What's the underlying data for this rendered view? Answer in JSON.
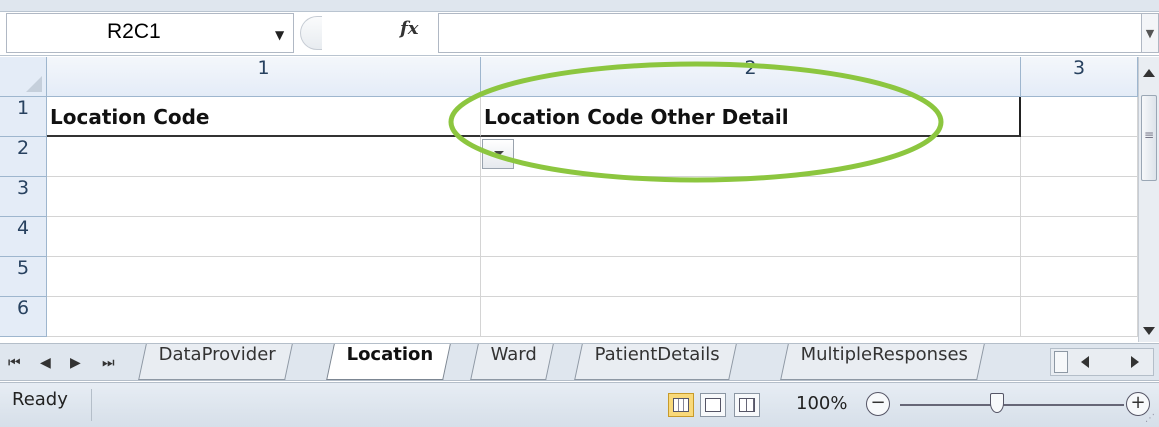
{
  "formula_bar": {
    "name_box": "R2C1",
    "fx_label": "fx",
    "formula_value": ""
  },
  "columns": [
    {
      "label": "1"
    },
    {
      "label": "2"
    },
    {
      "label": "3"
    }
  ],
  "rows": [
    {
      "label": "1",
      "cells": [
        "Location Code",
        "Location Code Other Detail",
        ""
      ]
    },
    {
      "label": "2",
      "cells": [
        "",
        "",
        ""
      ]
    },
    {
      "label": "3",
      "cells": [
        "",
        "",
        ""
      ]
    },
    {
      "label": "4",
      "cells": [
        "",
        "",
        ""
      ]
    },
    {
      "label": "5",
      "cells": [
        "",
        "",
        ""
      ]
    },
    {
      "label": "6",
      "cells": [
        "",
        "",
        ""
      ]
    }
  ],
  "sheet_tabs": [
    {
      "label": "DataProvider",
      "active": false
    },
    {
      "label": "Location",
      "active": true
    },
    {
      "label": "Ward",
      "active": false
    },
    {
      "label": "PatientDetails",
      "active": false
    },
    {
      "label": "MultipleResponses",
      "active": false
    }
  ],
  "status_bar": {
    "status": "Ready",
    "zoom": "100%",
    "zoom_minus": "−",
    "zoom_plus": "+"
  },
  "icons": {
    "nav_first": "⏮",
    "nav_prev": "◀",
    "nav_next": "▶",
    "nav_last": "⏭"
  },
  "colors": {
    "highlight": "#8cc63f",
    "header_bg": "#e4ecf7"
  }
}
